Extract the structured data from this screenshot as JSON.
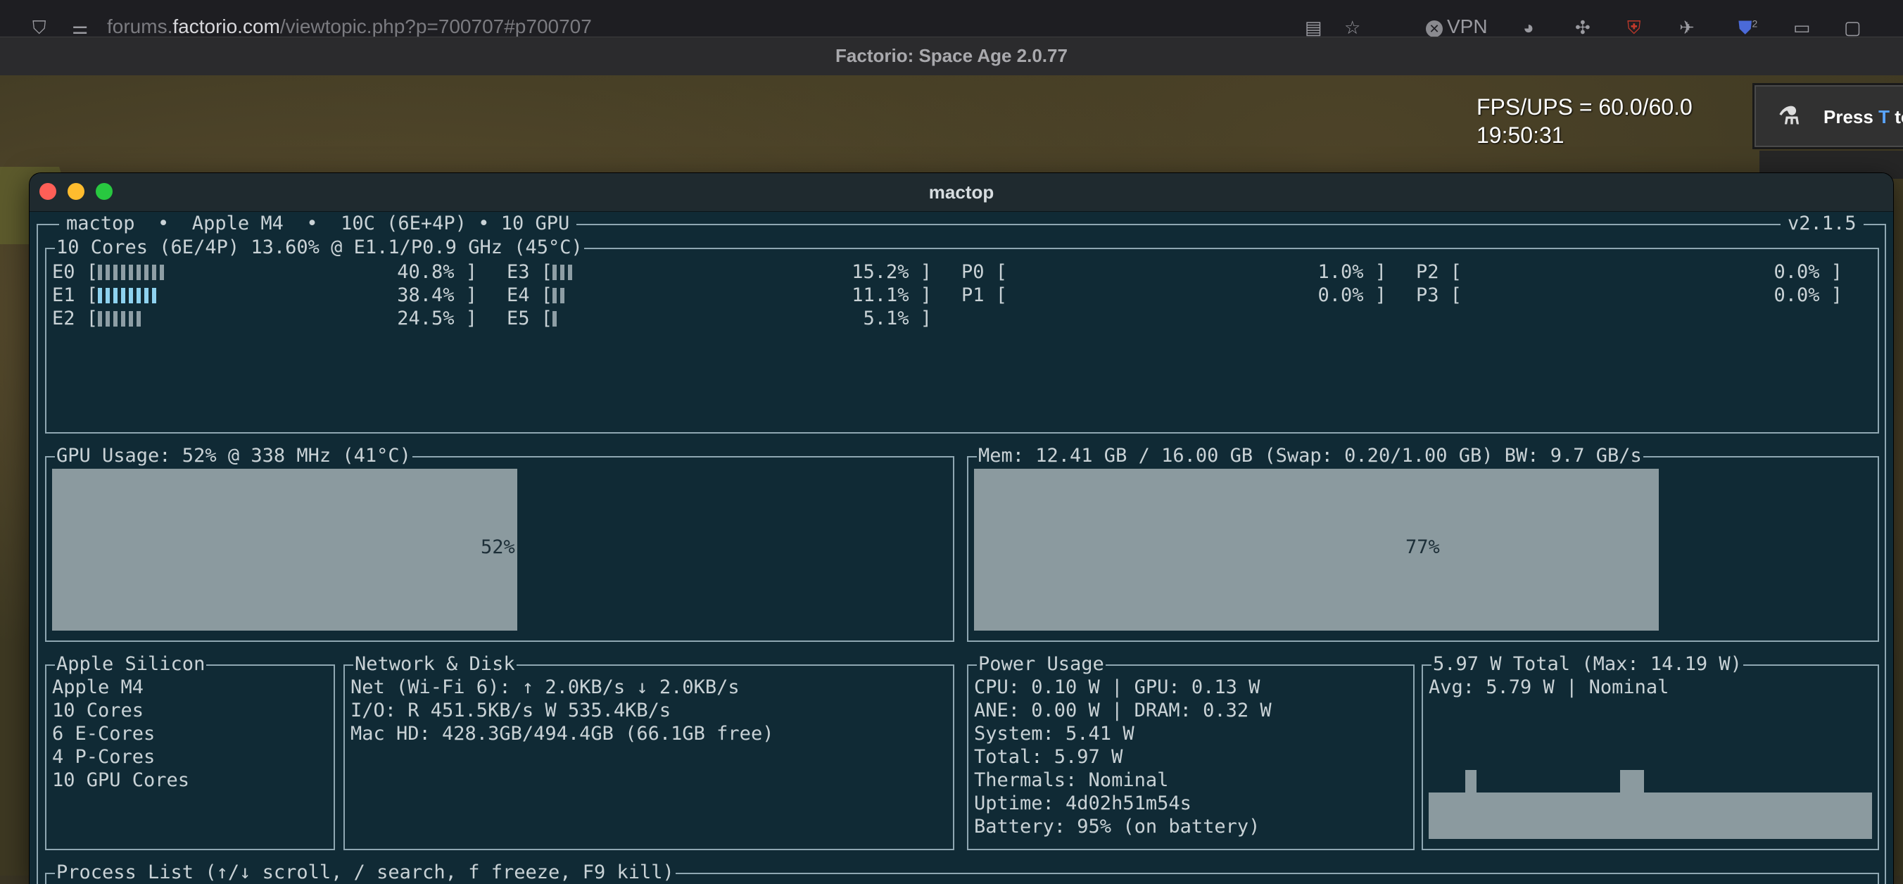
{
  "browser": {
    "url_prefix": "forums.",
    "url_host": "factorio.com",
    "url_path": "/viewtopic.php?p=700707#p700707",
    "vpn_label": "VPN",
    "badge_count": "2"
  },
  "game": {
    "window_title": "Factorio: Space Age 2.0.77",
    "fps_ups": "FPS/UPS = 60.0/60.0",
    "clock": "19:50:31",
    "hint_prefix": "Press ",
    "hint_key": "T",
    "hint_suffix": " to"
  },
  "terminal": {
    "window_title": "mactop",
    "header_left": "mactop  •  Apple M4  •  10C (6E+4P) • 10 GPU",
    "version": "v2.1.5",
    "cpu_title": "10 Cores (6E/4P) 13.60% @ E1.1/P0.9 GHz (45°C)",
    "cores": [
      {
        "name": "E0",
        "percent": "40.8%",
        "segments": 9,
        "highlight": false
      },
      {
        "name": "E1",
        "percent": "38.4%",
        "segments": 8,
        "highlight": true
      },
      {
        "name": "E2",
        "percent": "24.5%",
        "segments": 6,
        "highlight": false
      },
      {
        "name": "E3",
        "percent": "15.2%",
        "segments": 3,
        "highlight": false
      },
      {
        "name": "E4",
        "percent": "11.1%",
        "segments": 2,
        "highlight": false
      },
      {
        "name": "E5",
        "percent": "5.1%",
        "segments": 1,
        "highlight": false
      },
      {
        "name": "P0",
        "percent": "1.0%",
        "segments": 0,
        "highlight": false
      },
      {
        "name": "P1",
        "percent": "0.0%",
        "segments": 0,
        "highlight": false
      },
      {
        "name": "P2",
        "percent": "0.0%",
        "segments": 0,
        "highlight": false
      },
      {
        "name": "P3",
        "percent": "0.0%",
        "segments": 0,
        "highlight": false
      }
    ],
    "gpu": {
      "title": "GPU Usage: 52% @ 338 MHz (41°C)",
      "label": "52%",
      "fraction": 0.52
    },
    "mem": {
      "title": "Mem: 12.41 GB / 16.00 GB (Swap: 0.20/1.00 GB) BW: 9.7 GB/s",
      "label": "77%",
      "fraction": 0.77
    },
    "silicon": {
      "title": "Apple Silicon",
      "lines": [
        "Apple M4",
        "10 Cores",
        "6 E-Cores",
        "4 P-Cores",
        "10 GPU Cores"
      ]
    },
    "network": {
      "title": "Network & Disk",
      "lines": [
        "Net (Wi-Fi 6): ↑ 2.0KB/s ↓ 2.0KB/s",
        "I/O: R 451.5KB/s W 535.4KB/s",
        "Mac HD: 428.3GB/494.4GB (66.1GB free)"
      ]
    },
    "power": {
      "title": "Power Usage",
      "lines": [
        "CPU: 0.10 W | GPU: 0.13 W",
        "ANE: 0.00 W | DRAM: 0.32 W",
        "System: 5.41 W",
        "Total: 5.97 W",
        "Thermals: Nominal",
        "Uptime: 4d02h51m54s",
        "Battery: 95% (on battery)"
      ]
    },
    "total_power": {
      "title": "5.97 W Total (Max: 14.19 W)",
      "avg": "Avg: 5.79 W | Nominal"
    },
    "process_list_title": "Process List (↑/↓ scroll, / search, f freeze, F9 kill)"
  }
}
